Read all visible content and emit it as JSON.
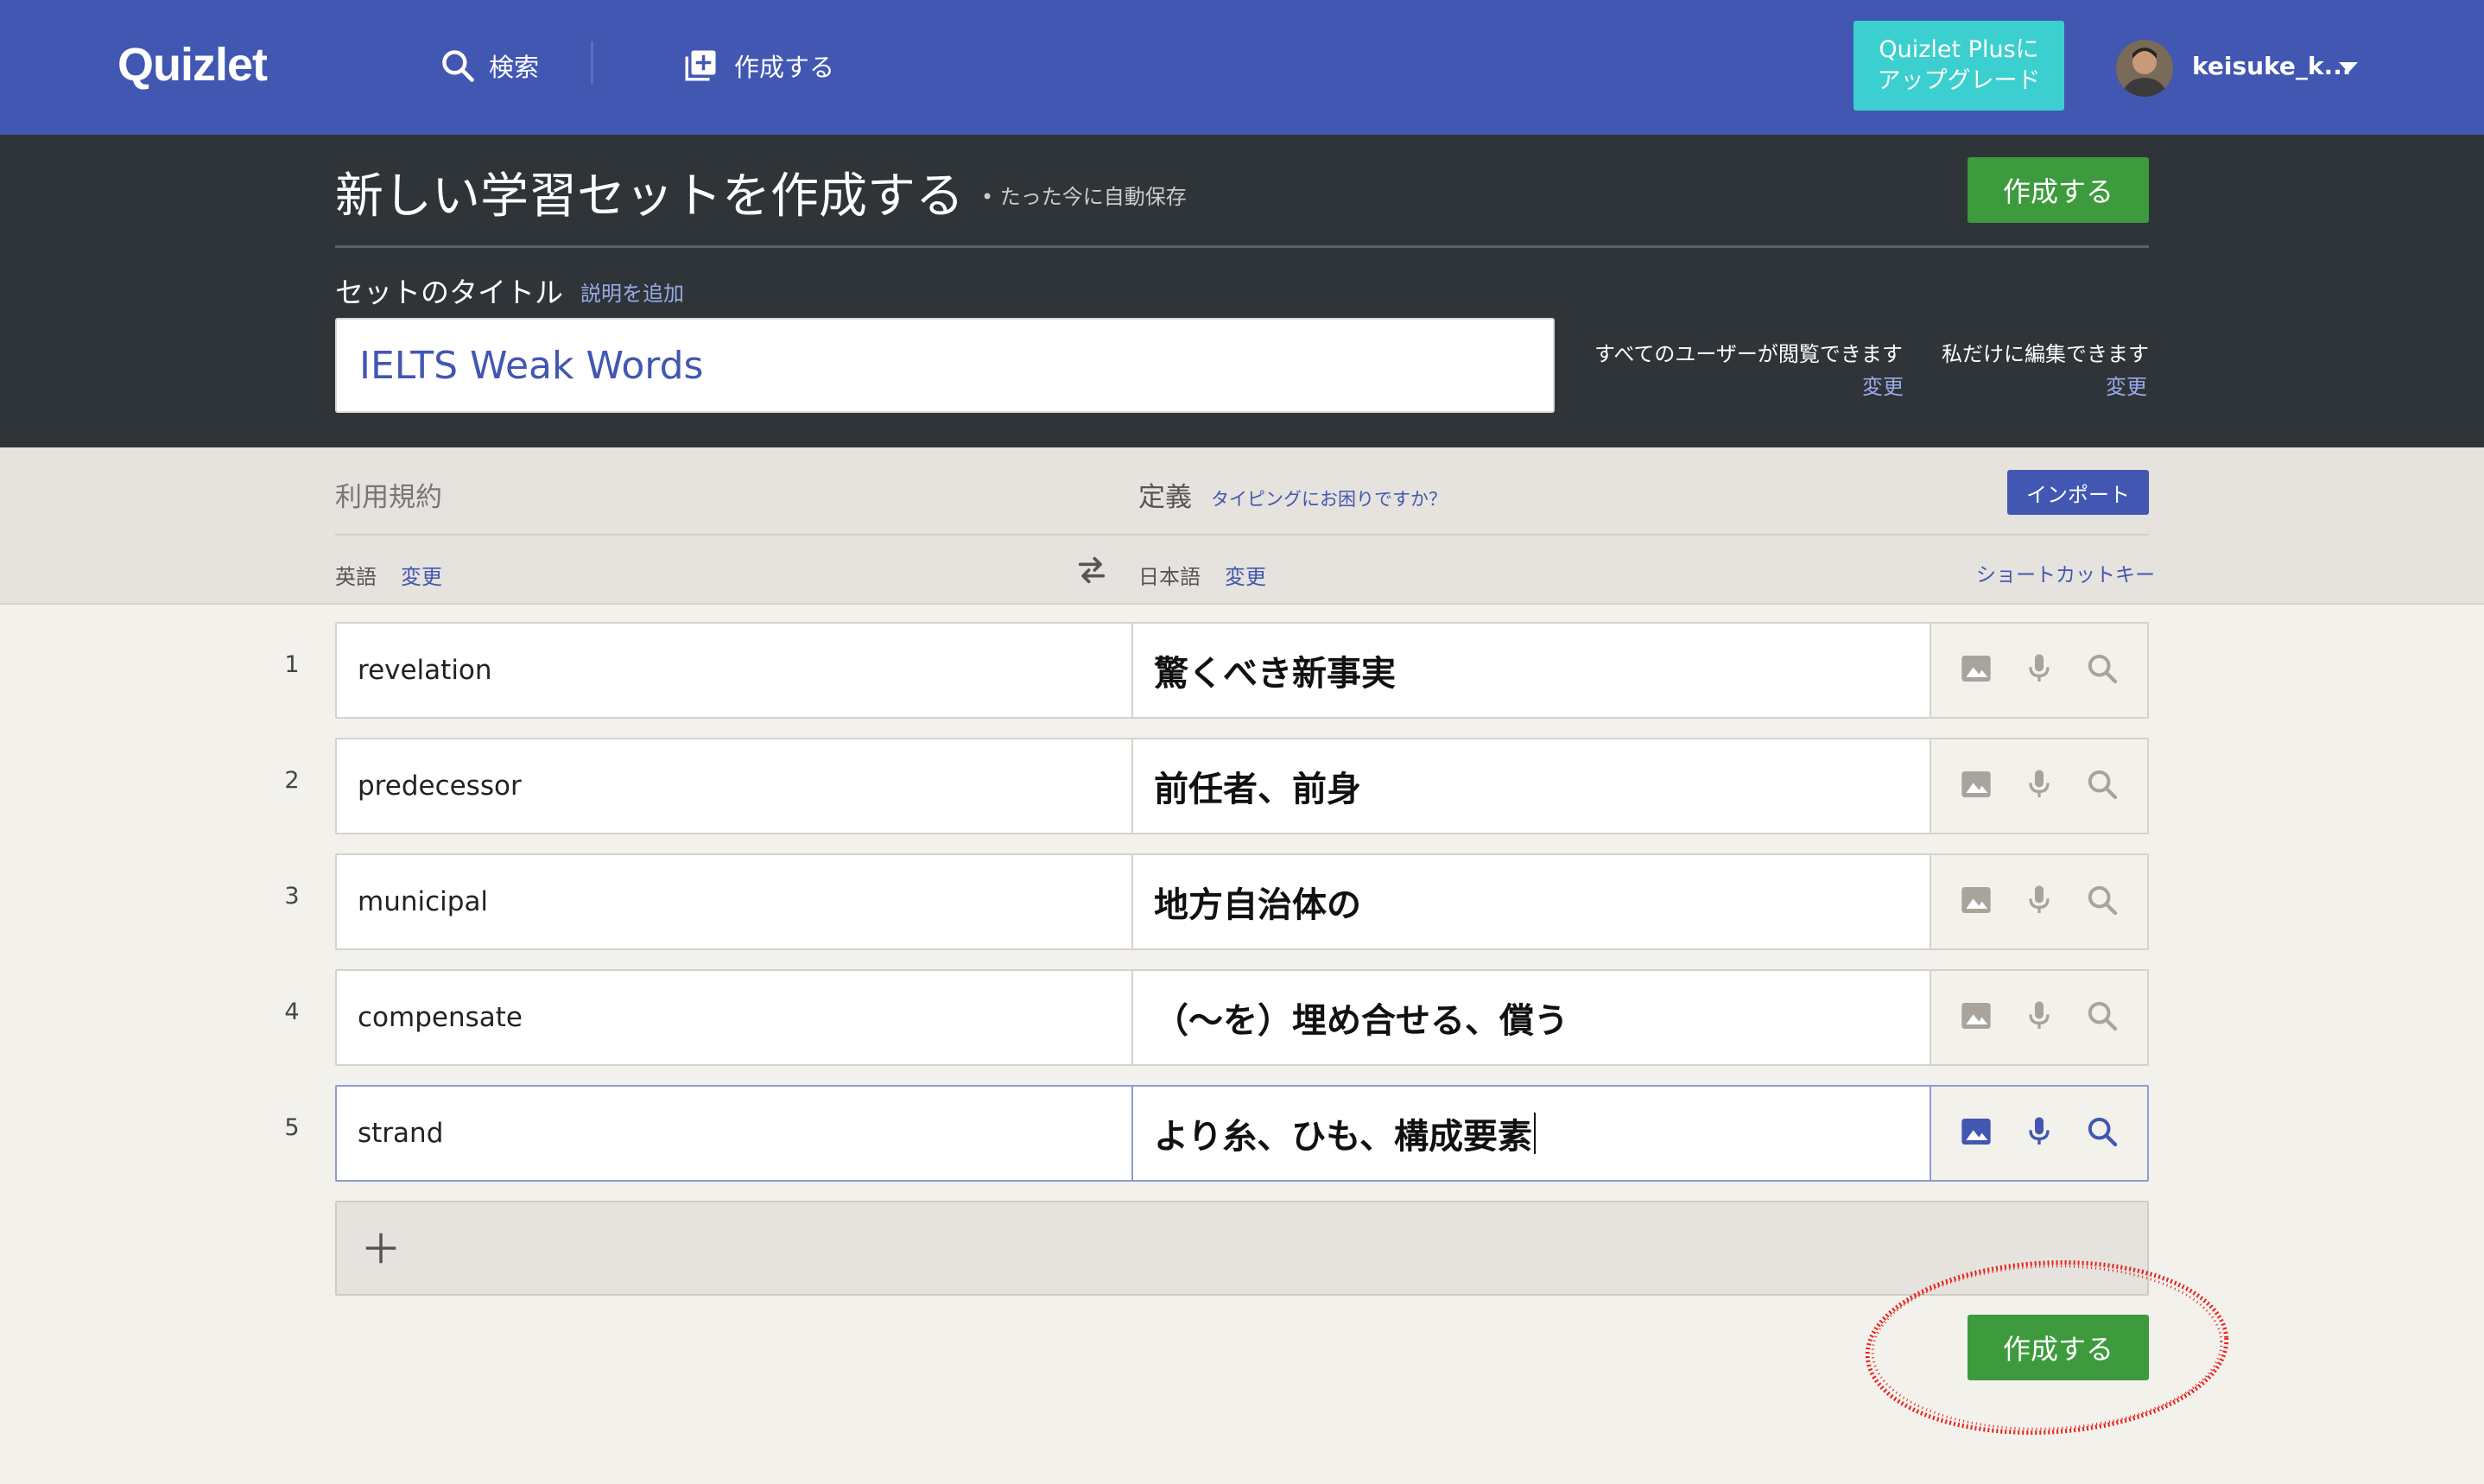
{
  "nav": {
    "logo": "Quizlet",
    "search_label": "検索",
    "create_label": "作成する",
    "upgrade_line1": "Quizlet Plusに",
    "upgrade_line2": "アップグレード",
    "username": "keisuke_k..."
  },
  "header": {
    "page_title": "新しい学習セットを作成する",
    "autosave": "• たった今に自動保存",
    "create_button": "作成する",
    "title_label": "セットのタイトル",
    "add_description": "説明を追加",
    "set_title": "IELTS Weak Words",
    "visibility_text": "すべてのユーザーが閲覧できます",
    "visibility_change": "変更",
    "edit_text": "私だけに編集できます",
    "edit_change": "変更"
  },
  "columns": {
    "terms_label": "利用規約",
    "definition_label": "定義",
    "typing_help": "タイピングにお困りですか？",
    "import_button": "インポート",
    "term_language": "英語",
    "term_language_change": "変更",
    "definition_language": "日本語",
    "definition_language_change": "変更",
    "shortcut_keys": "ショートカットキー"
  },
  "cards": [
    {
      "number": "1",
      "term": "revelation",
      "definition": "驚くべき新事実"
    },
    {
      "number": "2",
      "term": "predecessor",
      "definition": "前任者、前身"
    },
    {
      "number": "3",
      "term": "municipal",
      "definition": "地方自治体の"
    },
    {
      "number": "4",
      "term": "compensate",
      "definition": "（〜を）埋め合せる、償う"
    },
    {
      "number": "5",
      "term": "strand",
      "definition": "より糸、ひも、構成要素"
    }
  ],
  "active_card_index": 4,
  "row_tool_icons": [
    "image-icon",
    "microphone-icon",
    "search-icon"
  ],
  "add_card_icon": "plus-icon",
  "footer": {
    "create_button": "作成する"
  },
  "colors": {
    "nav_bg": "#4257b2",
    "header_bg": "#2e3437",
    "create_green": "#3d9b3d",
    "upgrade_teal": "#3ccfcf",
    "annotation_red": "#e8201a"
  }
}
